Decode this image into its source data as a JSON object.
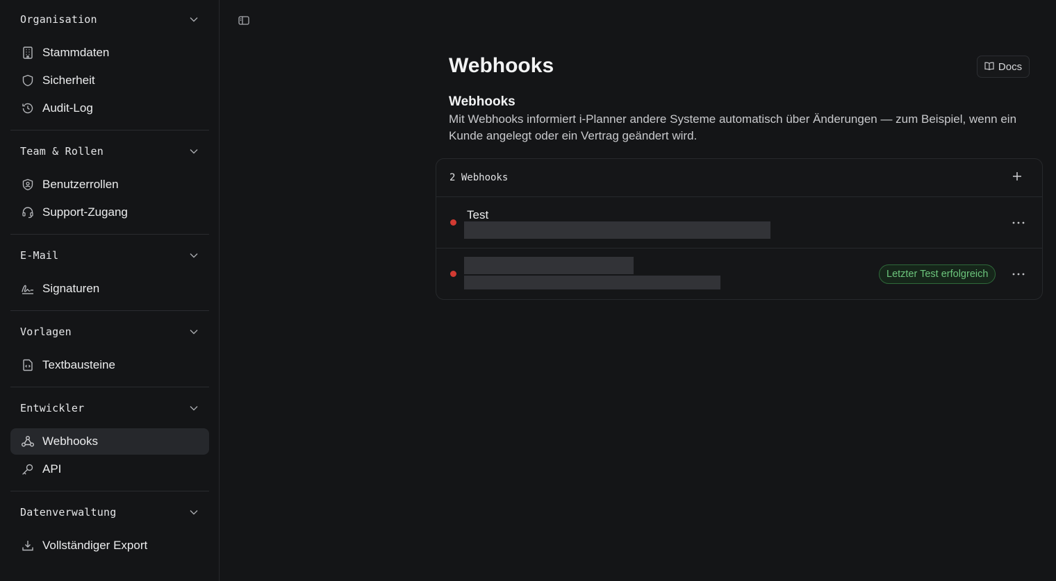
{
  "sidebar": {
    "groups": [
      {
        "title": "Organisation",
        "items": [
          {
            "label": "Stammdaten",
            "icon": "building-icon"
          },
          {
            "label": "Sicherheit",
            "icon": "shield-icon"
          },
          {
            "label": "Audit-Log",
            "icon": "history-icon"
          }
        ]
      },
      {
        "title": "Team & Rollen",
        "items": [
          {
            "label": "Benutzerrollen",
            "icon": "user-shield-icon"
          },
          {
            "label": "Support-Zugang",
            "icon": "headset-icon"
          }
        ]
      },
      {
        "title": "E-Mail",
        "items": [
          {
            "label": "Signaturen",
            "icon": "signature-icon"
          }
        ]
      },
      {
        "title": "Vorlagen",
        "items": [
          {
            "label": "Textbausteine",
            "icon": "file-code-icon"
          }
        ]
      },
      {
        "title": "Entwickler",
        "items": [
          {
            "label": "Webhooks",
            "icon": "webhook-icon",
            "active": true
          },
          {
            "label": "API",
            "icon": "key-icon"
          }
        ]
      },
      {
        "title": "Datenverwaltung",
        "items": [
          {
            "label": "Vollständiger Export",
            "icon": "download-icon"
          }
        ]
      }
    ]
  },
  "header": {
    "title": "Webhooks",
    "docs_label": "Docs"
  },
  "section": {
    "title": "Webhooks",
    "description": "Mit Webhooks informiert i-Planner andere Systeme automatisch über Änderungen — zum Beispiel, wenn ein Kunde angelegt oder ein Vertrag geändert wird."
  },
  "webhooks": {
    "count_label": "2 Webhooks",
    "rows": [
      {
        "name": "Test",
        "status_color": "#d23a32",
        "badge": ""
      },
      {
        "name": "",
        "status_color": "#d23a32",
        "badge": "Letzter Test erfolgreich"
      }
    ]
  },
  "colors": {
    "background": "#141517",
    "accent_success": "#6cc57c",
    "status_error": "#d23a32"
  }
}
